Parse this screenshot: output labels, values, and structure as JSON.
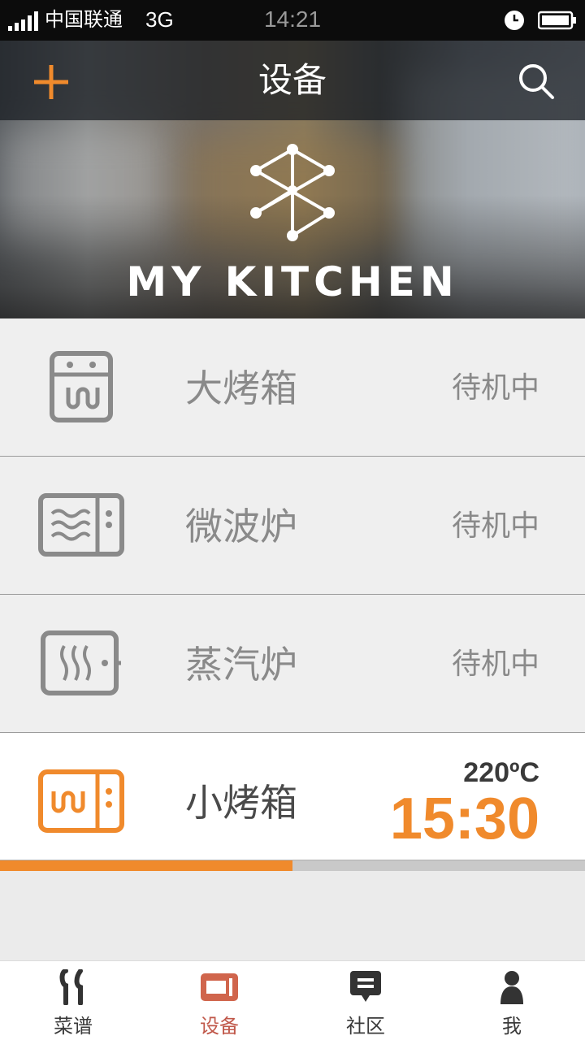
{
  "status_bar": {
    "carrier": "中国联通",
    "network": "3G",
    "time": "14:21"
  },
  "header": {
    "title": "设备",
    "add_icon": "plus-icon",
    "search_icon": "search-icon"
  },
  "banner": {
    "brand": "MY KITCHEN"
  },
  "devices": [
    {
      "name": "大烤箱",
      "status": "待机中",
      "icon": "oven-icon"
    },
    {
      "name": "微波炉",
      "status": "待机中",
      "icon": "microwave-icon"
    },
    {
      "name": "蒸汽炉",
      "status": "待机中",
      "icon": "steam-oven-icon"
    },
    {
      "name": "小烤箱",
      "temperature": "220ºC",
      "timer": "15:30",
      "icon": "small-oven-icon"
    }
  ],
  "progress": {
    "fraction": 0.5
  },
  "colors": {
    "accent": "#f08a2c",
    "active_tab": "#c0584a"
  },
  "tabs": [
    {
      "label": "菜谱",
      "icon": "fork-knife-icon"
    },
    {
      "label": "设备",
      "icon": "device-icon",
      "selected": true
    },
    {
      "label": "社区",
      "icon": "chat-icon"
    },
    {
      "label": "我",
      "icon": "person-icon"
    }
  ]
}
